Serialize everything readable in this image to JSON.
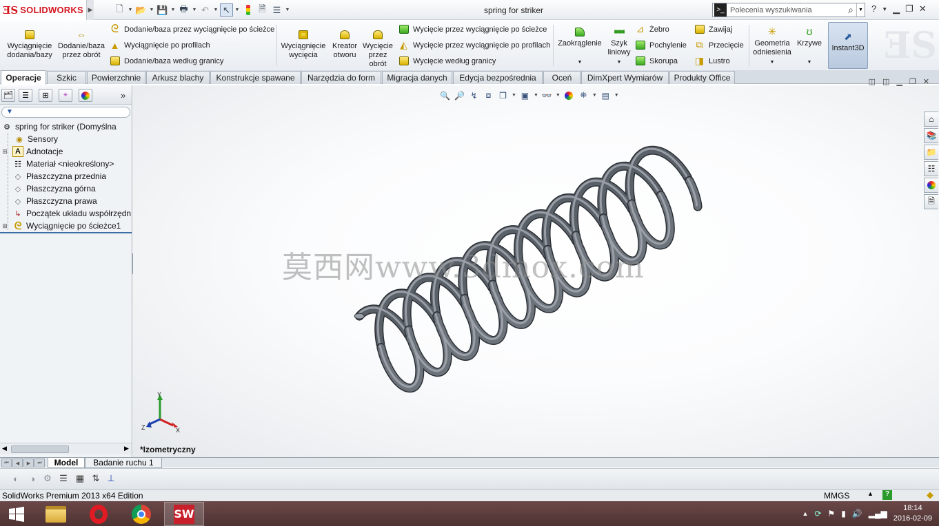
{
  "app": {
    "logo_text": "SOLIDWORKS",
    "document_title": "spring for striker"
  },
  "search": {
    "placeholder": "Polecenia wyszukiwania"
  },
  "ribbon": {
    "extruded_boss": "Wyciągnięcie dodania/bazy",
    "revolved_boss": "Dodanie/baza przez obrót",
    "swept_boss": "Dodanie/baza przez wyciągnięcie po ścieżce",
    "lofted_boss": "Wyciągnięcie po profilach",
    "boundary_boss": "Dodanie/baza według granicy",
    "extruded_cut": "Wyciągnięcie wycięcia",
    "hole_wizard": "Kreator otworu",
    "revolved_cut": "Wycięcie przez obrót",
    "swept_cut": "Wycięcie przez wyciągnięcie po ścieżce",
    "lofted_cut": "Wycięcie przez wyciągnięcie po profilach",
    "boundary_cut": "Wycięcie według granicy",
    "fillet": "Zaokrąglenie",
    "linear_pattern": "Szyk liniowy",
    "rib": "Żebro",
    "draft": "Pochylenie",
    "shell": "Skorupa",
    "wrap": "Zawijaj",
    "intersect": "Przecięcie",
    "mirror": "Lustro",
    "ref_geometry": "Geometria odniesienia",
    "curves": "Krzywe",
    "instant3d": "Instant3D"
  },
  "tabs": [
    "Operacje",
    "Szkic",
    "Powierzchnie",
    "Arkusz blachy",
    "Konstrukcje spawane",
    "Narzędzia do form",
    "Migracja danych",
    "Edycja bezpośrednia",
    "Oceń",
    "DimXpert Wymiarów",
    "Produkty Office"
  ],
  "tree": {
    "root": "spring for striker  (Domyślna",
    "items": [
      "Sensory",
      "Adnotacje",
      "Materiał <nieokreślony>",
      "Płaszczyzna przednia",
      "Płaszczyzna górna",
      "Płaszczyzna prawa",
      "Początek układu współrzędn",
      "Wyciągnięcie po ścieżce1"
    ]
  },
  "viewport": {
    "view_name": "*Izometryczny",
    "watermark": "莫西网www.3dmox.com",
    "triad": {
      "y": "Y",
      "x": "X",
      "z": "Z"
    }
  },
  "bottom_tabs": [
    "Model",
    "Badanie ruchu 1"
  ],
  "status": {
    "edition": "SolidWorks Premium 2013 x64 Edition",
    "units": "MMGS"
  },
  "taskbar": {
    "time": "18:14",
    "date": "2016-02-09"
  },
  "colors": {
    "accent": "#d3151f",
    "spring": "#6d737b",
    "taskbar": "#5a3c3c"
  }
}
